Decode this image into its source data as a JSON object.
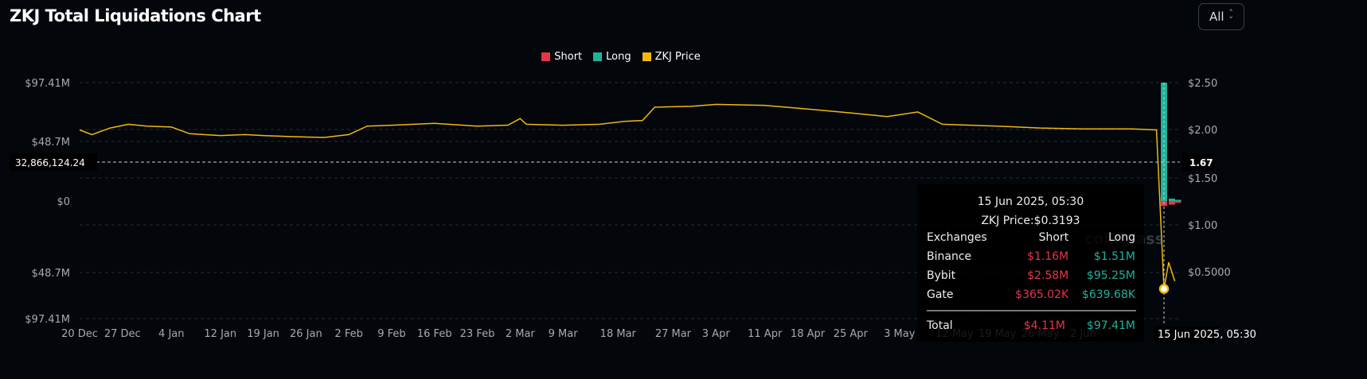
{
  "title": "ZKJ Total Liquidations Chart",
  "range_select": {
    "value": "All",
    "icon": "chevron-up-down-icon"
  },
  "watermark": "coinglass",
  "colors": {
    "short": "#e5364a",
    "long": "#1fb39a",
    "price": "#f0b90b",
    "background": "#03060b"
  },
  "crosshair": {
    "left_value": "32,866,124.24",
    "right_value": "1.67",
    "x_label": "15 Jun 2025, 05:30"
  },
  "tooltip": {
    "date": "15 Jun 2025, 05:30",
    "price": "ZKJ Price:$0.3193",
    "headers": [
      "Exchanges",
      "Short",
      "Long"
    ],
    "rows": [
      [
        "Binance",
        "$1.16M",
        "$1.51M"
      ],
      [
        "Bybit",
        "$2.58M",
        "$95.25M"
      ],
      [
        "Gate",
        "$365.02K",
        "$639.68K"
      ]
    ],
    "total": [
      "Total",
      "$4.11M",
      "$97.41M"
    ]
  },
  "chart_data": {
    "type": "bar+line",
    "title": "ZKJ Total Liquidations Chart",
    "legend": [
      "Short",
      "Long",
      "ZKJ Price"
    ],
    "legend_position": "top",
    "grid": true,
    "y_left_ticks": [
      "$97.41M",
      "$48.7M",
      "$0",
      "$48.7M",
      "$97.41M"
    ],
    "y_left_range": [
      -97.41,
      97.41
    ],
    "y_right_ticks": [
      "$2.50",
      "$2.00",
      "$1.50",
      "$1.00",
      "$0.5000"
    ],
    "y_right_range": [
      0.2,
      2.5
    ],
    "x_ticks": [
      "20 Dec",
      "27 Dec",
      "4 Jan",
      "12 Jan",
      "19 Jan",
      "26 Jan",
      "2 Feb",
      "9 Feb",
      "16 Feb",
      "23 Feb",
      "2 Mar",
      "9 Mar",
      "18 Mar",
      "27 Mar",
      "3 Apr",
      "11 Apr",
      "18 Apr",
      "25 Apr",
      "3 May",
      "12 May",
      "19 May",
      "26 May",
      "2 Jun"
    ],
    "x_tick_dates": [
      "2024-12-20",
      "2024-12-27",
      "2025-01-04",
      "2025-01-12",
      "2025-01-19",
      "2025-01-26",
      "2025-02-02",
      "2025-02-09",
      "2025-02-16",
      "2025-02-23",
      "2025-03-02",
      "2025-03-09",
      "2025-03-18",
      "2025-03-27",
      "2025-04-03",
      "2025-04-11",
      "2025-04-18",
      "2025-04-25",
      "2025-05-03",
      "2025-05-12",
      "2025-05-19",
      "2025-05-26",
      "2025-06-02"
    ],
    "price": [
      [
        "2024-12-20",
        2.0
      ],
      [
        "2024-12-22",
        1.95
      ],
      [
        "2024-12-25",
        2.02
      ],
      [
        "2024-12-28",
        2.06
      ],
      [
        "2024-12-31",
        2.04
      ],
      [
        "2025-01-04",
        2.03
      ],
      [
        "2025-01-07",
        1.96
      ],
      [
        "2025-01-12",
        1.94
      ],
      [
        "2025-01-16",
        1.95
      ],
      [
        "2025-01-19",
        1.94
      ],
      [
        "2025-01-23",
        1.93
      ],
      [
        "2025-01-29",
        1.92
      ],
      [
        "2025-02-02",
        1.95
      ],
      [
        "2025-02-05",
        2.04
      ],
      [
        "2025-02-09",
        2.05
      ],
      [
        "2025-02-16",
        2.07
      ],
      [
        "2025-02-23",
        2.04
      ],
      [
        "2025-02-28",
        2.05
      ],
      [
        "2025-03-02",
        2.12
      ],
      [
        "2025-03-03",
        2.06
      ],
      [
        "2025-03-09",
        2.05
      ],
      [
        "2025-03-15",
        2.06
      ],
      [
        "2025-03-19",
        2.09
      ],
      [
        "2025-03-22",
        2.1
      ],
      [
        "2025-03-24",
        2.24
      ],
      [
        "2025-03-30",
        2.25
      ],
      [
        "2025-04-03",
        2.27
      ],
      [
        "2025-04-11",
        2.26
      ],
      [
        "2025-04-18",
        2.22
      ],
      [
        "2025-04-25",
        2.18
      ],
      [
        "2025-05-01",
        2.14
      ],
      [
        "2025-05-06",
        2.19
      ],
      [
        "2025-05-10",
        2.06
      ],
      [
        "2025-05-19",
        2.04
      ],
      [
        "2025-05-26",
        2.02
      ],
      [
        "2025-06-02",
        2.01
      ],
      [
        "2025-06-10",
        2.01
      ],
      [
        "2025-06-14",
        2.0
      ],
      [
        "2025-06-15T05:30",
        0.3193
      ],
      [
        "2025-06-16",
        0.6
      ],
      [
        "2025-06-17",
        0.4
      ]
    ],
    "bars": [
      {
        "date": "2025-06-15T05:30",
        "short": 4.11,
        "long": 97.41
      },
      {
        "date": "2025-06-16",
        "short": 3.0,
        "long": 2.0
      },
      {
        "date": "2025-06-17",
        "short": 1.5,
        "long": 1.0
      }
    ]
  }
}
